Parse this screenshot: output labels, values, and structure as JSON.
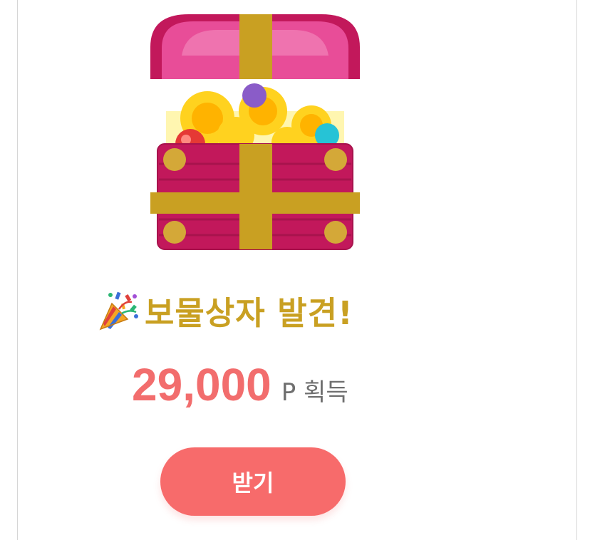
{
  "reward": {
    "title": "보물상자 발견!",
    "amount": "29,000",
    "unit_label": "P 획득",
    "claim_label": "받기"
  },
  "icons": {
    "hero": "treasure-chest-icon",
    "title_decoration": "party-popper-icon"
  },
  "colors": {
    "title": "#c9a022",
    "amount": "#f26d6d",
    "unit": "#6f6f6f",
    "button": "#f76b6b",
    "button_text": "#ffffff",
    "chest_body": "#c2185b",
    "chest_lid": "#e84d98",
    "chest_band": "#c9a022"
  }
}
